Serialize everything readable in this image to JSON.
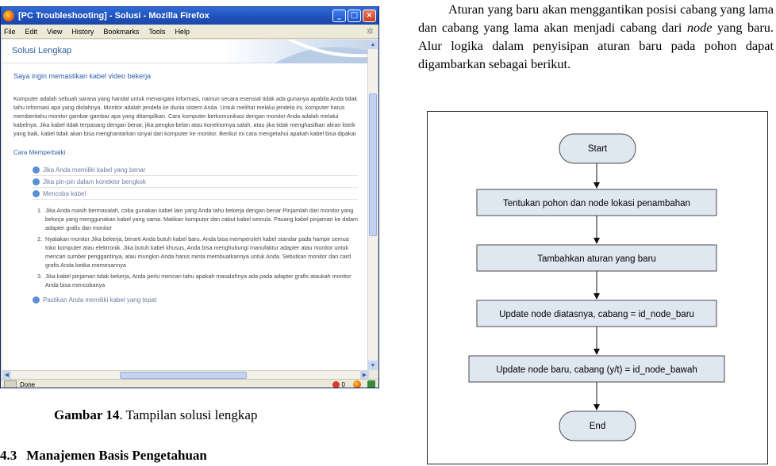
{
  "browser": {
    "window_title": "[PC Troubleshooting] - Solusi - Mozilla Firefox",
    "menu": [
      "File",
      "Edit",
      "View",
      "History",
      "Bookmarks",
      "Tools",
      "Help"
    ],
    "page_title": "Solusi Lengkap",
    "headline": "Saya ingin memastikan kabel video bekerja",
    "paragraph": "Komputer adalah sebuah sarana yang handal untuk menangani informasi, namun secara esensial tidak ada gunanya apabila Anda tidak tahu informasi apa yang diolahnya. Monitor adalah jendela ke dunia sistem Anda. Untuk melihat melalui jendela ini, komputer harus memberitahu monitor gambar-gambar apa yang ditampilkan. Cara komputer berkomunikasi dengan monitor Anda adalah melalui kabelnya. Jika kabel tidak terpasang dengan benar, jika pengka-belan atau konektornya salah, atau jika tidak menghasilkan aliran listrik yang baik, kabel tidak akan bisa menghantarkan sinyal dari komputer ke monitor. Berikut ini cara mengetahui apakah kabel bisa dipakai",
    "subheading": "Cara Memperbaiki",
    "links": [
      "Jika Anda memiliki kabel yang benar",
      "Jika pin-pin dalam konektor bengkok",
      "Mencoba kabel"
    ],
    "steps": [
      "Jika Anda masih bermasalah, coba gunakan kabel lain yang Anda tahu bekerja dengan benar Pinjamlah dari monitor yang bekerja yang menggunakan kabel yang sama. Matikan komputer dan cabut kabel semula. Pasang kabel pinjaman ke dalam adapter grafis dan monitor",
      "Nyalakan monitor Jika bekerja, berarti Anda butuh kabel baru. Anda bisa memperoleh kabel standar pada hampir semua toko komputer atau elektronik. Jika butuh kabel khusus, Anda bisa menghubungi manufaktur adapter atau monitor untuk mencari sumber penggantinya, atau mungkin Anda harus minta membuatkannya untuk Anda. Sebutkan monitor dan card grafis Anda ketika memesannya",
      "Jika kabel pinjaman tidak bekerja, Anda perlu mencari tahu apakah masalahnya ada pada adapter grafis ataukah monitor Anda bisa mencobanya"
    ],
    "last_link": "Pastikan Anda memiliki kabel yang tepat",
    "status": "Done",
    "error_count": "0"
  },
  "caption": {
    "label": "Gambar 14",
    "text": ". Tampilan solusi lengkap"
  },
  "section": {
    "number": "4.3",
    "title": "Manajemen Basis Pengetahuan"
  },
  "right_paragraph": {
    "before": "Aturan yang baru akan menggantikan posisi cabang yang lama dan cabang yang lama akan menjadi cabang dari ",
    "emphasis": "node",
    "after": " yang baru. Alur logika dalam penyisipan aturan baru pada pohon dapat digambarkan sebagai berikut."
  },
  "flowchart": {
    "start": "Start",
    "steps": [
      "Tentukan pohon dan node lokasi penambahan",
      "Tambahkan aturan yang  baru",
      "Update node diatasnya, cabang = id_node_baru",
      "Update node baru, cabang (y/t) = id_node_bawah"
    ],
    "end": "End",
    "fill": "#dfe7f1",
    "stroke": "#4a4a4a"
  }
}
